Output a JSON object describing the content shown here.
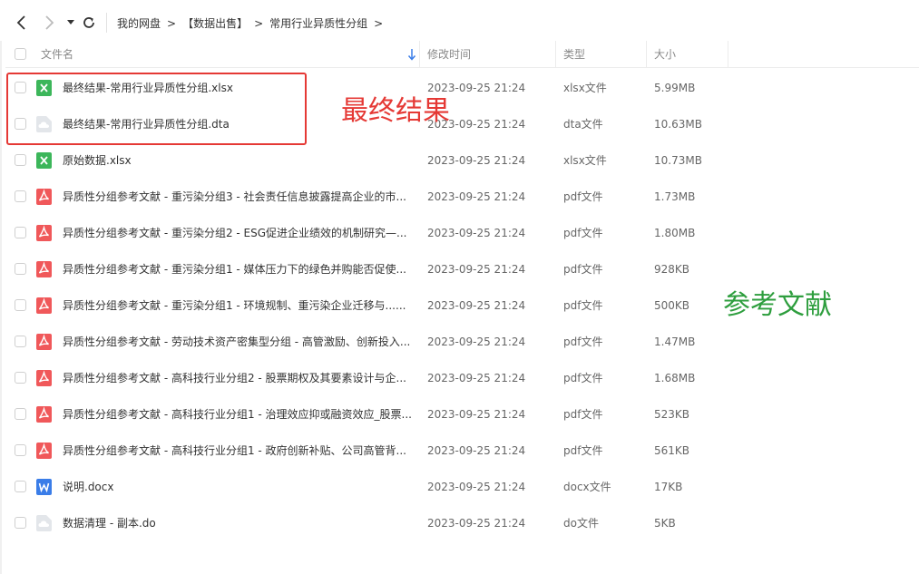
{
  "breadcrumb": {
    "items": [
      "我的网盘",
      "【数据出售】",
      "常用行业异质性分组"
    ],
    "separator": ">"
  },
  "columns": {
    "name": "文件名",
    "modified": "修改时间",
    "type": "类型",
    "size": "大小"
  },
  "files": [
    {
      "name": "最终结果-常用行业异质性分组.xlsx",
      "modified": "2023-09-25 21:24",
      "type": "xlsx文件",
      "size": "5.99MB",
      "icon": "excel-icon"
    },
    {
      "name": "最终结果-常用行业异质性分组.dta",
      "modified": "2023-09-25 21:24",
      "type": "dta文件",
      "size": "10.63MB",
      "icon": "cloud-file-icon"
    },
    {
      "name": "原始数据.xlsx",
      "modified": "2023-09-25 21:24",
      "type": "xlsx文件",
      "size": "10.73MB",
      "icon": "excel-icon"
    },
    {
      "name": "异质性分组参考文献 - 重污染分组3 - 社会责任信息披露提高企业的市...",
      "modified": "2023-09-25 21:24",
      "type": "pdf文件",
      "size": "1.73MB",
      "icon": "pdf-icon"
    },
    {
      "name": "异质性分组参考文献 - 重污染分组2 - ESG促进企业绩效的机制研究—...",
      "modified": "2023-09-25 21:24",
      "type": "pdf文件",
      "size": "1.80MB",
      "icon": "pdf-icon"
    },
    {
      "name": "异质性分组参考文献 - 重污染分组1 - 媒体压力下的绿色并购能否促使...",
      "modified": "2023-09-25 21:24",
      "type": "pdf文件",
      "size": "928KB",
      "icon": "pdf-icon"
    },
    {
      "name": "异质性分组参考文献 - 重污染分组1 - 环境规制、重污染企业迁移与......",
      "modified": "2023-09-25 21:24",
      "type": "pdf文件",
      "size": "500KB",
      "icon": "pdf-icon"
    },
    {
      "name": "异质性分组参考文献 - 劳动技术资产密集型分组 - 高管激励、创新投入...",
      "modified": "2023-09-25 21:24",
      "type": "pdf文件",
      "size": "1.47MB",
      "icon": "pdf-icon"
    },
    {
      "name": "异质性分组参考文献 - 高科技行业分组2 - 股票期权及其要素设计与企...",
      "modified": "2023-09-25 21:24",
      "type": "pdf文件",
      "size": "1.68MB",
      "icon": "pdf-icon"
    },
    {
      "name": "异质性分组参考文献 - 高科技行业分组1 - 治理效应抑或融资效应_股票...",
      "modified": "2023-09-25 21:24",
      "type": "pdf文件",
      "size": "523KB",
      "icon": "pdf-icon"
    },
    {
      "name": "异质性分组参考文献 - 高科技行业分组1 - 政府创新补贴、公司高管背...",
      "modified": "2023-09-25 21:24",
      "type": "pdf文件",
      "size": "561KB",
      "icon": "pdf-icon"
    },
    {
      "name": "说明.docx",
      "modified": "2023-09-25 21:24",
      "type": "docx文件",
      "size": "17KB",
      "icon": "word-icon"
    },
    {
      "name": "数据清理 - 副本.do",
      "modified": "2023-09-25 21:24",
      "type": "do文件",
      "size": "5KB",
      "icon": "cloud-file-icon"
    }
  ],
  "annotations": {
    "final_result": "最终结果",
    "references": "参考文献"
  },
  "colors": {
    "excel": "#3cb65a",
    "pdf": "#f0585a",
    "word": "#3a7de8",
    "cloud": "#c9ced6",
    "annotation_red": "#e53935",
    "annotation_green": "#2e9e3e"
  }
}
